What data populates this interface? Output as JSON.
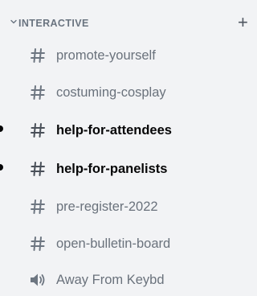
{
  "category": {
    "label": "INTERACTIVE",
    "add_glyph": "+"
  },
  "channels": [
    {
      "name": "promote-yourself",
      "type": "text",
      "icon": "hash-icon",
      "unread": false
    },
    {
      "name": "costuming-cosplay",
      "type": "text",
      "icon": "hash-icon",
      "unread": false
    },
    {
      "name": "help-for-attendees",
      "type": "text",
      "icon": "hash-icon",
      "unread": true
    },
    {
      "name": "help-for-panelists",
      "type": "text",
      "icon": "hash-icon",
      "unread": true
    },
    {
      "name": "pre-register-2022",
      "type": "text",
      "icon": "hash-icon",
      "unread": false
    },
    {
      "name": "open-bulletin-board",
      "type": "text",
      "icon": "hash-icon",
      "unread": false
    },
    {
      "name": "Away From Keybd",
      "type": "voice",
      "icon": "speaker-icon",
      "unread": false
    }
  ],
  "colors": {
    "background": "#f2f3f5",
    "muted_text": "#6a727c",
    "unread_text": "#060607",
    "category_text": "#6a7480"
  }
}
